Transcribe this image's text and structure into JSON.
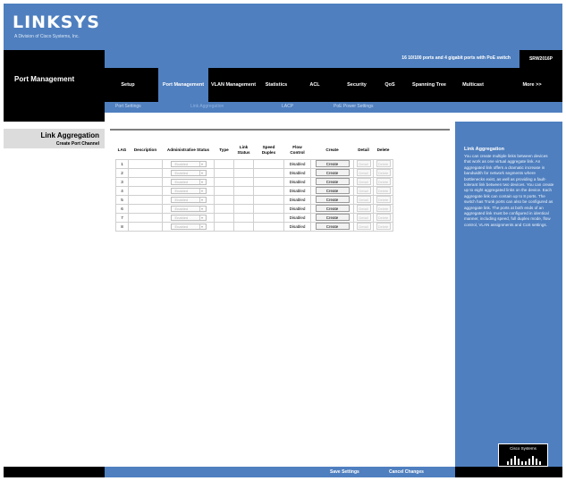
{
  "brand": {
    "logo": "LINKSYS",
    "tagline": "A Division of Cisco Systems, Inc."
  },
  "section": {
    "title": "Port Management"
  },
  "info": {
    "ports_text": "16 10/100 ports and 4 gigabit ports with PoE switch",
    "model": "SRW2016P"
  },
  "nav": {
    "items": [
      {
        "label": "Setup"
      },
      {
        "label": "Port Management"
      },
      {
        "label": "VLAN Management"
      },
      {
        "label": "Statistics"
      },
      {
        "label": "ACL"
      },
      {
        "label": "Security"
      },
      {
        "label": "QoS"
      },
      {
        "label": "Spanning Tree"
      },
      {
        "label": "Multicast"
      },
      {
        "label": "More >>"
      }
    ]
  },
  "subtabs": [
    {
      "label": "Port Settings"
    },
    {
      "label": "Link Aggregation"
    },
    {
      "label": "LACP"
    },
    {
      "label": "PoE Power Settings"
    }
  ],
  "left": {
    "title": "Link Aggregation",
    "link": "Create Port Channel"
  },
  "table": {
    "headers": {
      "lag": "LAG",
      "description": "Description",
      "admin_status": "Administrative Status",
      "type": "Type",
      "link_status": "Link Status",
      "speed_duplex": "Speed Duplex",
      "flow_control": "Flow Control",
      "create": "Create",
      "detail": "Detail",
      "delete": "Delete"
    },
    "rows": [
      {
        "lag": "1",
        "admin": "Enabled",
        "flow": "Disabled",
        "create": "Create",
        "detail": "Detail",
        "delete": "Delete"
      },
      {
        "lag": "2",
        "admin": "Enabled",
        "flow": "Disabled",
        "create": "Create",
        "detail": "Detail",
        "delete": "Delete"
      },
      {
        "lag": "3",
        "admin": "Enabled",
        "flow": "Disabled",
        "create": "Create",
        "detail": "Detail",
        "delete": "Delete"
      },
      {
        "lag": "4",
        "admin": "Enabled",
        "flow": "Disabled",
        "create": "Create",
        "detail": "Detail",
        "delete": "Delete"
      },
      {
        "lag": "5",
        "admin": "Enabled",
        "flow": "Disabled",
        "create": "Create",
        "detail": "Detail",
        "delete": "Delete"
      },
      {
        "lag": "6",
        "admin": "Enabled",
        "flow": "Disabled",
        "create": "Create",
        "detail": "Detail",
        "delete": "Delete"
      },
      {
        "lag": "7",
        "admin": "Enabled",
        "flow": "Disabled",
        "create": "Create",
        "detail": "Detail",
        "delete": "Delete"
      },
      {
        "lag": "8",
        "admin": "Enabled",
        "flow": "Disabled",
        "create": "Create",
        "detail": "Detail",
        "delete": "Delete"
      }
    ]
  },
  "help": {
    "title": "Link Aggregation",
    "text": "You can create multiple links between devices that work as one virtual aggregate link. An aggregated link offers a dramatic increase in bandwidth for network segments where bottlenecks exist, as well as providing a fault-tolerant link between two devices. You can create up to eight aggregated links on the device. Each aggregate link can contain up to 8 ports. The switch has Trunk ports can also be configured as aggregate link. The ports at both ends of an aggregated link must be configured in identical manner, including speed, full duplex mode, flow control, VLAN assignments and CoS settings."
  },
  "footer": {
    "save": "Save Settings",
    "cancel": "Cancel Changes"
  },
  "cisco": {
    "label": "Cisco Systems"
  },
  "colors": {
    "brand_blue": "#4f7fbf",
    "black": "#000000"
  }
}
